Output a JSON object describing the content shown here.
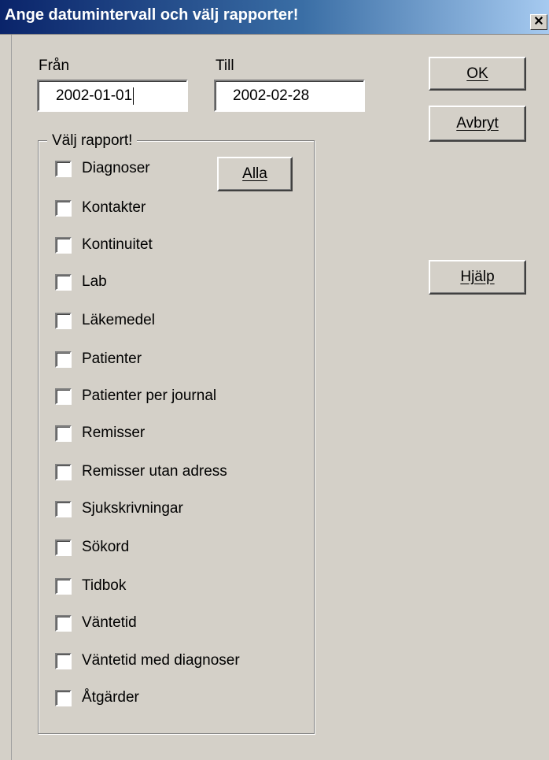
{
  "window": {
    "title": "Ange datumintervall och välj rapporter!",
    "close_glyph": "✕"
  },
  "date_range": {
    "from_label": "Från",
    "from_value": "2002-01-01",
    "to_label": "Till",
    "to_value": "2002-02-28"
  },
  "buttons": {
    "ok": "OK",
    "cancel": "Avbryt",
    "help": "Hjälp",
    "all": "Alla"
  },
  "report_group": {
    "legend": "Välj rapport!",
    "items": [
      {
        "label": "Diagnoser",
        "checked": false
      },
      {
        "label": "Kontakter",
        "checked": false
      },
      {
        "label": "Kontinuitet",
        "checked": false
      },
      {
        "label": "Lab",
        "checked": false
      },
      {
        "label": "Läkemedel",
        "checked": false
      },
      {
        "label": "Patienter",
        "checked": false
      },
      {
        "label": "Patienter per journal",
        "checked": false
      },
      {
        "label": "Remisser",
        "checked": false
      },
      {
        "label": "Remisser utan adress",
        "checked": false
      },
      {
        "label": "Sjukskrivningar",
        "checked": false
      },
      {
        "label": "Sökord",
        "checked": false
      },
      {
        "label": "Tidbok",
        "checked": false
      },
      {
        "label": "Väntetid",
        "checked": false
      },
      {
        "label": "Väntetid med diagnoser",
        "checked": false
      },
      {
        "label": "Åtgärder",
        "checked": false
      }
    ]
  }
}
